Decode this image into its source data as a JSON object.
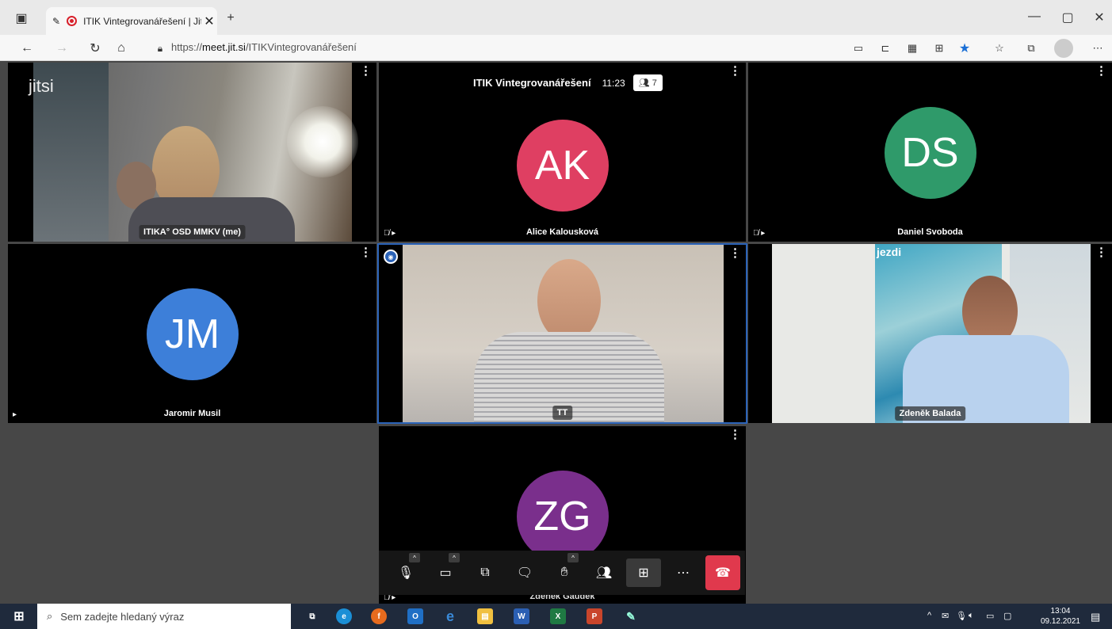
{
  "browser": {
    "tab_title": "ITIK Vintegrovanářešení | Jit",
    "tab_close": "✕",
    "new_tab": "+",
    "url_prefix": "https://",
    "url_domain": "meet.jit.si",
    "url_path": "/ITIKVintegrovanářešení",
    "window_controls": {
      "minimize": "—",
      "restore": "▢",
      "close": "✕"
    }
  },
  "meeting": {
    "logo": "jitsi",
    "room_title": "ITIK Vintegrovanářešení",
    "elapsed": "11:23",
    "participant_count": "7",
    "participants": [
      {
        "name": "ITIKA° OSD MMKV (me)",
        "type": "video"
      },
      {
        "name": "Alice Kalousková",
        "initials": "AK",
        "color": "#df3f62",
        "type": "avatar"
      },
      {
        "name": "Daniel Svoboda",
        "initials": "DS",
        "color": "#2f9a6a",
        "type": "avatar"
      },
      {
        "name": "Jaromir Musil",
        "initials": "JM",
        "color": "#3d7fd9",
        "type": "avatar"
      },
      {
        "name": "TT",
        "type": "video",
        "active_speaker": true
      },
      {
        "name": "Zdeněk Balada",
        "type": "video"
      },
      {
        "name": "Zdeněk Gaudek",
        "initials": "ZG",
        "color": "#7a2f8c",
        "type": "avatar"
      }
    ]
  },
  "taskbar": {
    "search_placeholder": "Sem zadejte hledaný výraz",
    "time": "13:04",
    "date": "09.12.2021"
  }
}
